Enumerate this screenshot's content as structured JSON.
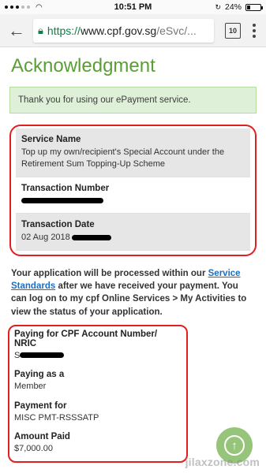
{
  "status_bar": {
    "time": "10:51 PM",
    "battery": "24%",
    "battery_level": 0.24
  },
  "browser": {
    "url_scheme": "https://",
    "url_host": "www.cpf.gov.sg",
    "url_path": "/eSvc/...",
    "tab_count": "10"
  },
  "page": {
    "title": "Acknowledgment",
    "notice": "Thank you for using our ePayment service.",
    "details": {
      "service_name_label": "Service Name",
      "service_name_value": "Top up my own/recipient's Special Account under the Retirement Sum Topping-Up Scheme",
      "transaction_number_label": "Transaction Number",
      "transaction_date_label": "Transaction Date",
      "transaction_date_value": "02 Aug 2018"
    },
    "info": {
      "text_before": "Your application will be processed within our ",
      "link_text": "Service Standards",
      "text_after": " after we have received your payment. You can log on to my cpf Online Services > My Activities to view the status of your application."
    },
    "payment": {
      "account_label": "Paying for CPF Account Number/ NRIC",
      "account_prefix": "S",
      "paying_as_label": "Paying as a",
      "paying_as_value": "Member",
      "payment_for_label": "Payment for",
      "payment_for_value": "MISC PMT-RSSSATP",
      "amount_label": "Amount Paid",
      "amount_value": "$7,000.00"
    }
  },
  "watermark": "jilaxzone.com",
  "colors": {
    "accent": "#5a9e36",
    "highlight_border": "#e02020",
    "link": "#1a6fc4"
  }
}
